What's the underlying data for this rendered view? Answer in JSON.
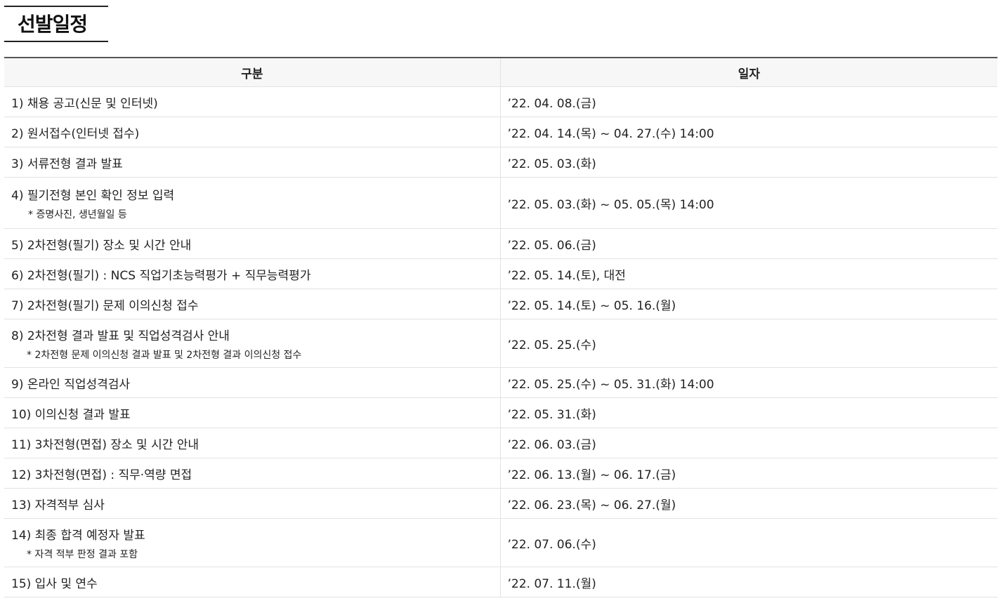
{
  "header": {
    "title": "선발일정"
  },
  "table": {
    "columns": [
      "구분",
      "일자"
    ],
    "rows": [
      {
        "item": "1) 채용 공고(신문 및 인터넷)",
        "note": "",
        "date": "’22. 04. 08.(금)"
      },
      {
        "item": "2) 원서접수(인터넷 접수)",
        "note": "",
        "date": "’22. 04. 14.(목) ~ 04. 27.(수) 14:00"
      },
      {
        "item": "3) 서류전형 결과 발표",
        "note": "",
        "date": "’22. 05. 03.(화)"
      },
      {
        "item": "4) 필기전형 본인 확인 정보 입력",
        "note": "* 증명사진, 생년월일 등",
        "date": "’22. 05. 03.(화) ~ 05. 05.(목) 14:00"
      },
      {
        "item": "5) 2차전형(필기) 장소 및 시간 안내",
        "note": "",
        "date": "’22. 05. 06.(금)"
      },
      {
        "item": "6) 2차전형(필기) : NCS 직업기초능력평가 + 직무능력평가",
        "note": "",
        "date": "’22. 05. 14.(토), 대전"
      },
      {
        "item": "7) 2차전형(필기) 문제 이의신청 접수",
        "note": "",
        "date": "’22. 05. 14.(토) ~ 05. 16.(월)"
      },
      {
        "item": "8) 2차전형 결과 발표 및 직업성격검사 안내",
        "note": "* 2차전형 문제 이의신청 결과 발표 및 2차전형 결과 이의신청 접수",
        "date": "’22. 05. 25.(수)"
      },
      {
        "item": "9) 온라인 직업성격검사",
        "note": "",
        "date": "’22. 05. 25.(수) ~ 05. 31.(화) 14:00"
      },
      {
        "item": "10) 이의신청 결과 발표",
        "note": "",
        "date": "’22. 05. 31.(화)"
      },
      {
        "item": "11) 3차전형(면접) 장소 및 시간 안내",
        "note": "",
        "date": "’22. 06. 03.(금)"
      },
      {
        "item": "12) 3차전형(면접) : 직무·역량 면접",
        "note": "",
        "date": "’22. 06. 13.(월) ~ 06. 17.(금)"
      },
      {
        "item": "13) 자격적부 심사",
        "note": "",
        "date": "’22. 06. 23.(목) ~ 06. 27.(월)"
      },
      {
        "item": "14) 최종 합격 예정자 발표",
        "note": "* 자격 적부 판정 결과 포함",
        "date": "’22. 07. 06.(수)"
      },
      {
        "item": "15) 입사 및 연수",
        "note": "",
        "date": "’22. 07. 11.(월)"
      }
    ]
  }
}
